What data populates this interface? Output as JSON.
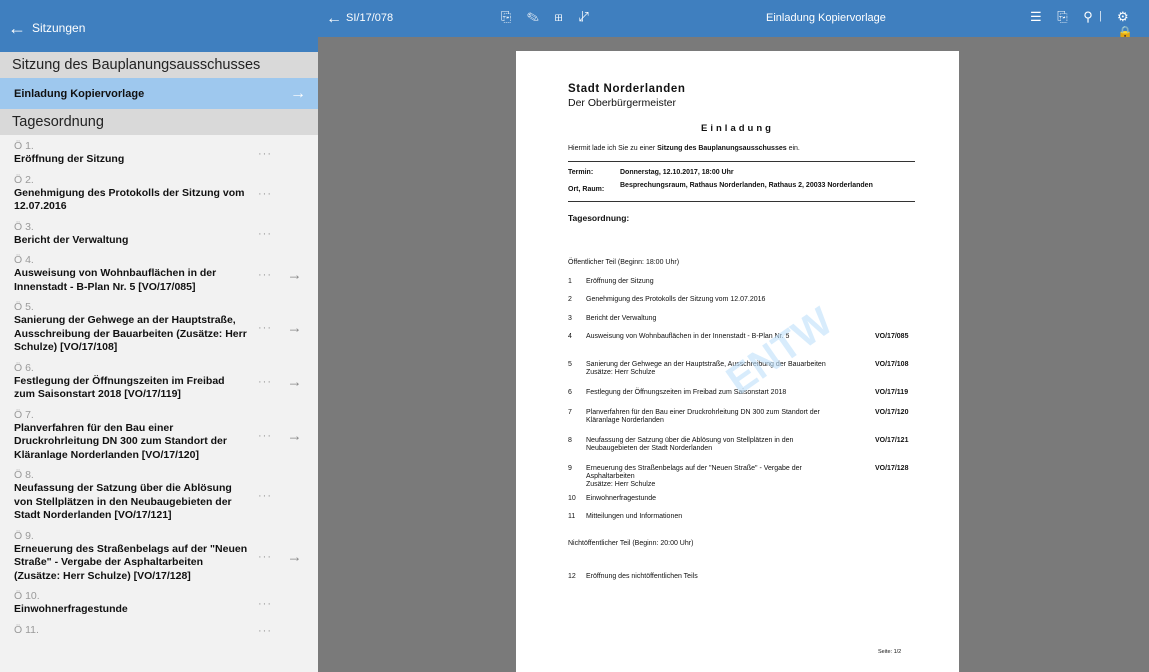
{
  "sidebar": {
    "back_label": "Sitzungen",
    "session_title": "Sitzung des Bauplanungsausschusses",
    "selected_doc": "Einladung Kopiervorlage",
    "agenda_header": "Tagesordnung",
    "items": [
      {
        "num": "Ö 1.",
        "title": "Eröffnung der Sitzung",
        "more": "···",
        "arrow": ""
      },
      {
        "num": "Ö 2.",
        "title": "Genehmigung des Protokolls der Sitzung vom 12.07.2016",
        "more": "···",
        "arrow": ""
      },
      {
        "num": "Ö 3.",
        "title": "Bericht der Verwaltung",
        "more": "···",
        "arrow": ""
      },
      {
        "num": "Ö 4.",
        "title": "Ausweisung von Wohnbauflächen in der Innenstadt - B-Plan Nr. 5 [VO/17/085]",
        "more": "···",
        "arrow": "→"
      },
      {
        "num": "Ö 5.",
        "title": "Sanierung der Gehwege an der Hauptstraße, Ausschreibung der Bauarbeiten (Zusätze: Herr Schulze) [VO/17/108]",
        "more": "···",
        "arrow": "→"
      },
      {
        "num": "Ö 6.",
        "title": "Festlegung der Öffnungszeiten im Freibad zum Saisonstart 2018 [VO/17/119]",
        "more": "···",
        "arrow": "→"
      },
      {
        "num": "Ö 7.",
        "title": "Planverfahren für den Bau einer Druckrohrleitung DN 300 zum Standort der Kläranlage Norderlanden [VO/17/120]",
        "more": "···",
        "arrow": "→"
      },
      {
        "num": "Ö 8.",
        "title": "Neufassung der Satzung über die Ablösung von Stellplätzen in den Neubaugebieten der Stadt Norderlanden [VO/17/121]",
        "more": "···",
        "arrow": ""
      },
      {
        "num": "Ö 9.",
        "title": "Erneuerung des Straßenbelags auf der \"Neuen Straße\" - Vergabe der Asphaltarbeiten (Zusätze: Herr Schulze) [VO/17/128]",
        "more": "···",
        "arrow": "→"
      },
      {
        "num": "Ö 10.",
        "title": "Einwohnerfragestunde",
        "more": "···",
        "arrow": ""
      },
      {
        "num": "Ö 11.",
        "title": "",
        "more": "···",
        "arrow": ""
      }
    ]
  },
  "topbar": {
    "ref": "SI/17/078",
    "title": "Einladung Kopiervorlage",
    "tools_left": "⎘ ✎ ⊞ ⤢",
    "tools_right": "☰ ⎘ ⚲",
    "tools_far": "⚙ 🔒",
    "sep": "|"
  },
  "document": {
    "city": "Stadt Norderlanden",
    "mayor": "Der Oberbürgermeister",
    "heading": "Einladung",
    "intro_pre": "Hiermit lade ich Sie zu einer ",
    "intro_bold": "Sitzung des Bauplanungsausschusses",
    "intro_post": " ein.",
    "termin_label": "Termin:",
    "termin_value": "Donnerstag, 12.10.2017, 18:00 Uhr",
    "ort_label": "Ort, Raum:",
    "ort_value": "Besprechungsraum, Rathaus Norderlanden, Rathaus 2, 20033 Norderlanden",
    "tops_label": "Tagesordnung:",
    "public_part": "Öffentlicher Teil (Beginn: 18:00 Uhr)",
    "private_part": "Nichtöffentlicher Teil (Beginn: 20:00 Uhr)",
    "rows": [
      {
        "n": "1",
        "t": "Eröffnung der Sitzung",
        "v": ""
      },
      {
        "n": "2",
        "t": "Genehmigung des Protokolls der Sitzung vom 12.07.2016",
        "v": ""
      },
      {
        "n": "3",
        "t": "Bericht der Verwaltung",
        "v": ""
      },
      {
        "n": "4",
        "t": "Ausweisung von Wohnbauflächen in der Innenstadt - B-Plan Nr. 5",
        "v": "VO/17/085"
      },
      {
        "n": "5",
        "t": "Sanierung der Gehwege an der Hauptstraße, Ausschreibung der Bauarbeiten\n Zusätze: Herr Schulze",
        "v": "VO/17/108"
      },
      {
        "n": "6",
        "t": "Festlegung der Öffnungszeiten im Freibad zum Saisonstart 2018",
        "v": "VO/17/119"
      },
      {
        "n": "7",
        "t": "Planverfahren für den Bau einer Druckrohrleitung DN 300 zum Standort der Kläranlage Norderlanden",
        "v": "VO/17/120"
      },
      {
        "n": "8",
        "t": "Neufassung der Satzung über die Ablösung von Stellplätzen in den Neubaugebieten der Stadt Norderlanden",
        "v": "VO/17/121"
      },
      {
        "n": "9",
        "t": "Erneuerung des Straßenbelags auf der \"Neuen Straße\" - Vergabe der Asphaltarbeiten\n Zusätze: Herr Schulze",
        "v": "VO/17/128"
      },
      {
        "n": "10",
        "t": "Einwohnerfragestunde",
        "v": ""
      },
      {
        "n": "11",
        "t": "Mitteilungen und Informationen",
        "v": ""
      }
    ],
    "private_rows": [
      {
        "n": "12",
        "t": "Eröffnung des nichtöffentlichen Teils",
        "v": ""
      }
    ],
    "footer": "Seite: 1/2",
    "watermark": "ENTW"
  }
}
